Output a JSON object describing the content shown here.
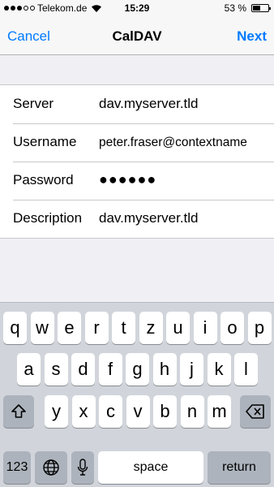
{
  "status_bar": {
    "carrier": "Telekom.de",
    "time": "15:29",
    "battery_percent_label": "53 %",
    "battery_level": 0.53,
    "signal_bars": 3,
    "signal_total": 5,
    "icons": [
      "wifi-icon",
      "battery-icon",
      "signal-icon"
    ]
  },
  "nav": {
    "cancel_label": "Cancel",
    "title": "CalDAV",
    "next_label": "Next",
    "accent": "#007aff"
  },
  "form": {
    "rows": [
      {
        "label": "Server",
        "value": "dav.myserver.tld"
      },
      {
        "label": "Username",
        "value": "peter.fraser@contextname"
      },
      {
        "label": "Password",
        "value": "●●●●●●"
      },
      {
        "label": "Description",
        "value": "dav.myserver.tld"
      }
    ]
  },
  "keyboard": {
    "row1": [
      "q",
      "w",
      "e",
      "r",
      "t",
      "z",
      "u",
      "i",
      "o",
      "p"
    ],
    "row2": [
      "a",
      "s",
      "d",
      "f",
      "g",
      "h",
      "j",
      "k",
      "l"
    ],
    "row3": [
      "y",
      "x",
      "c",
      "v",
      "b",
      "n",
      "m"
    ],
    "numbers_label": "123",
    "space_label": "space",
    "return_label": "return",
    "icons": [
      "shift-icon",
      "backspace-icon",
      "globe-icon",
      "microphone-icon"
    ]
  }
}
